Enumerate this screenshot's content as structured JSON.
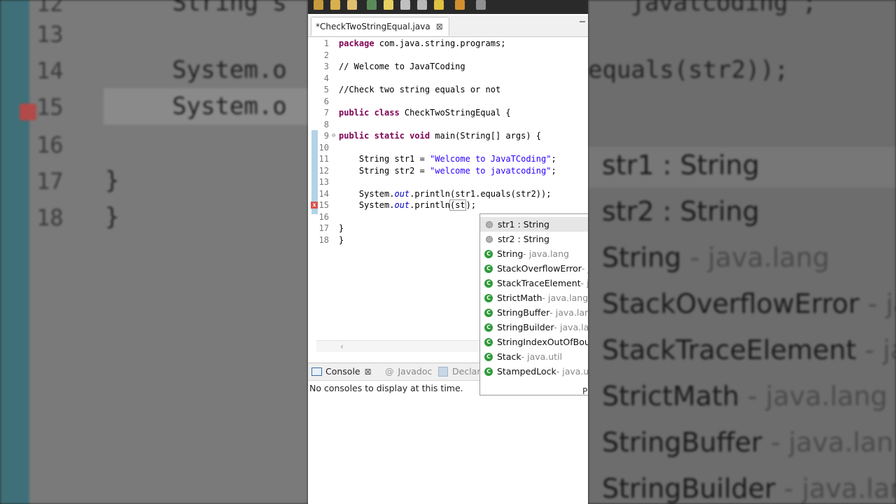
{
  "background_left": {
    "line_numbers": [
      "12",
      "13",
      "14",
      "15",
      "16",
      "17",
      "18"
    ],
    "line12_code": "String s",
    "line12_tail": "'javatcoding';",
    "line14_code": "System.o",
    "line14_tail": "equals(str2));",
    "line15_code": "System.o",
    "line17_code": "}",
    "line18_code": "}"
  },
  "background_right": {
    "items": [
      {
        "name": "str1 : String",
        "pkg": ""
      },
      {
        "name": "str2 : String",
        "pkg": ""
      },
      {
        "name": "String",
        "pkg": " - java.lang"
      },
      {
        "name": "StackOverflowError",
        "pkg": " - ja"
      },
      {
        "name": "StackTraceElement",
        "pkg": " - ja"
      },
      {
        "name": "StrictMath",
        "pkg": " - java.lang"
      },
      {
        "name": "StringBuffer",
        "pkg": " - java.lan"
      },
      {
        "name": "StringBuilder",
        "pkg": " - java.lan"
      }
    ]
  },
  "editor": {
    "tab_title": "*CheckTwoStringEqual.java",
    "line_numbers": [
      "1",
      "2",
      "3",
      "4",
      "5",
      "6",
      "7",
      "8",
      "9",
      "10",
      "11",
      "12",
      "13",
      "14",
      "15",
      "16",
      "17",
      "18"
    ],
    "code": {
      "l1_kw": "package",
      "l1_rest": " com.java.string.programs;",
      "l3": "// Welcome to JavaTCoding",
      "l5": "//Check two string equals or not",
      "l7_kw": "public class",
      "l7_rest": " CheckTwoStringEqual {",
      "l9_kw": "public static void",
      "l9_rest": " main(String[] args) {",
      "l11_a": "    String str1 = ",
      "l11_str": "\"Welcome to JavaTCoding\"",
      "l11_b": ";",
      "l12_a": "    String str2 = ",
      "l12_str": "\"welcome to javatcoding\"",
      "l12_b": ";",
      "l14_a": "    System.",
      "l14_out": "out",
      "l14_b": ".println(str1.equals(str2));",
      "l15_a": "    System.",
      "l15_out": "out",
      "l15_b": ".println",
      "l15_box": "(st",
      "l15_c": ");",
      "l17": "}",
      "l18": "}"
    }
  },
  "views": {
    "console_tab": "Console",
    "javadoc_tab": "Javadoc",
    "declaration_tab": "Declar",
    "console_message": "No consoles to display at this time."
  },
  "autocomplete": {
    "items": [
      {
        "name": "str1 : String",
        "pkg": "",
        "kind": "local"
      },
      {
        "name": "str2 : String",
        "pkg": "",
        "kind": "local"
      },
      {
        "name": "String",
        "pkg": " - java.lang",
        "kind": "class"
      },
      {
        "name": "StackOverflowError",
        "pkg": " - j",
        "kind": "class"
      },
      {
        "name": "StackTraceElement",
        "pkg": " - ja",
        "kind": "class"
      },
      {
        "name": "StrictMath",
        "pkg": " - java.lang",
        "kind": "class"
      },
      {
        "name": "StringBuffer",
        "pkg": " - java.lan",
        "kind": "class"
      },
      {
        "name": "StringBuilder",
        "pkg": " - java.lan",
        "kind": "class"
      },
      {
        "name": "StringIndexOutOfBou",
        "pkg": "",
        "kind": "class"
      },
      {
        "name": "Stack",
        "pkg": " - java.util",
        "kind": "class"
      },
      {
        "name": "StampedLock",
        "pkg": " - java.u",
        "kind": "class"
      }
    ],
    "status_char": "P"
  },
  "colors": {
    "keyword": "#7f0055",
    "string": "#2a00ff",
    "comment": "#3f7f5f",
    "field": "#0000c0",
    "class_icon": "#2e9a3a",
    "error": "#d9534f"
  }
}
